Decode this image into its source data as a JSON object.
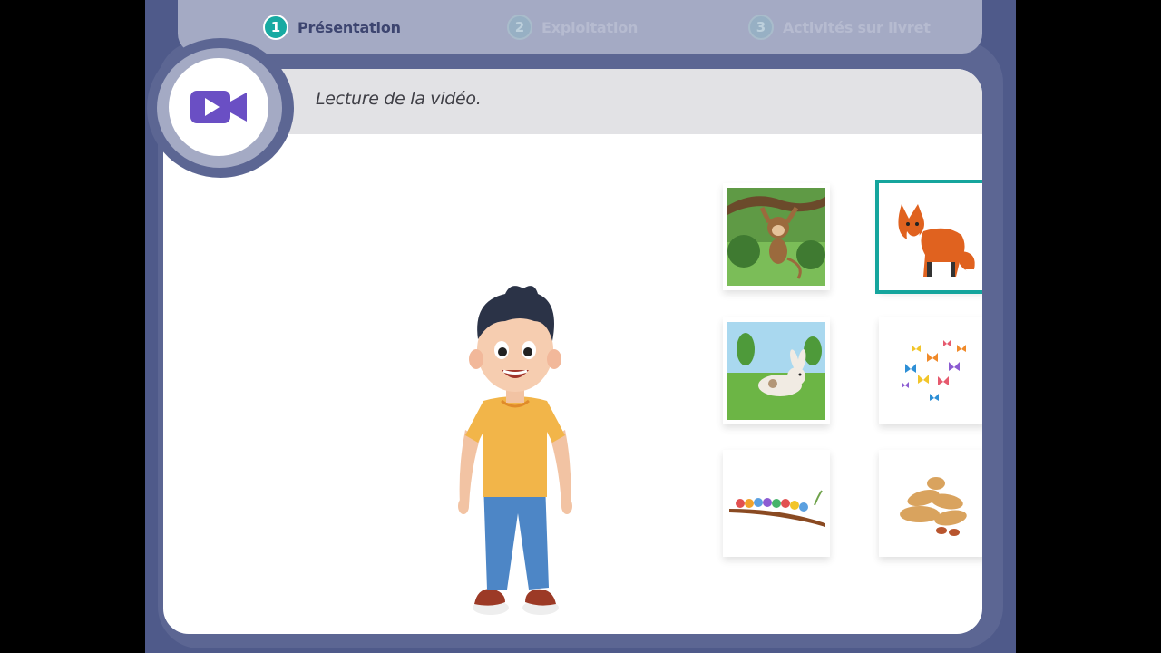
{
  "steps": [
    {
      "number": "1",
      "label": "Présentation",
      "state": "active"
    },
    {
      "number": "2",
      "label": "Exploitation",
      "state": "inactive"
    },
    {
      "number": "3",
      "label": "Activités sur livret",
      "state": "inactive"
    }
  ],
  "header": {
    "title": "Lecture de la vidéo.",
    "icon": "video-camera-icon"
  },
  "colors": {
    "accent": "#18aaa2",
    "frame": "#4f5a8a",
    "icon": "#6a4fc4"
  },
  "tiles": [
    {
      "name": "monkey-image",
      "selected": false
    },
    {
      "name": "fox-image",
      "selected": true
    },
    {
      "name": "rabbit-image",
      "selected": false
    },
    {
      "name": "butterflies-image",
      "selected": false
    },
    {
      "name": "birds-on-branch-image",
      "selected": false
    },
    {
      "name": "peanuts-image",
      "selected": false
    }
  ]
}
